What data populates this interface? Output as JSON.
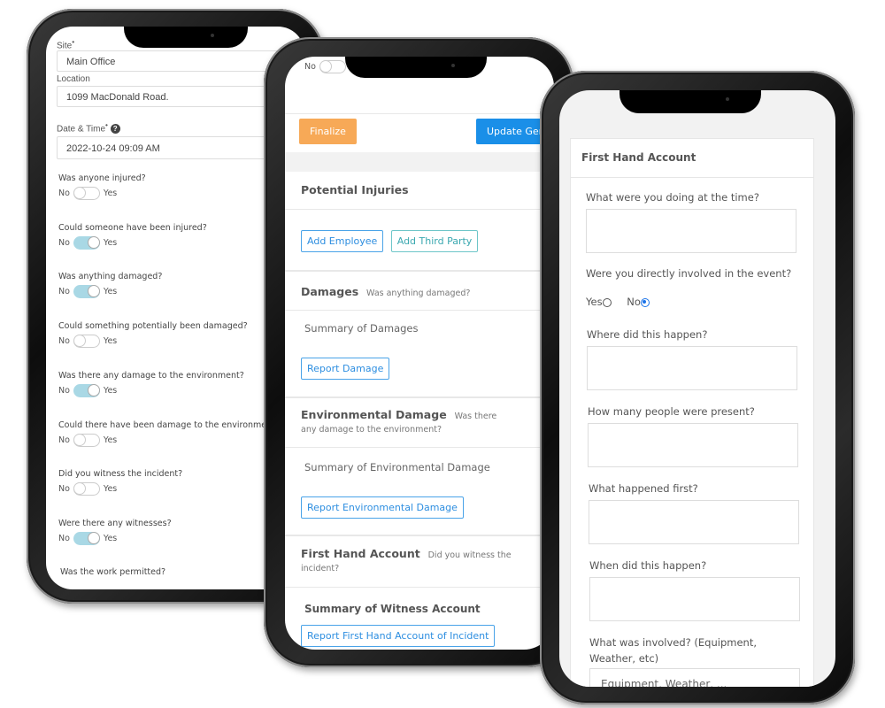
{
  "phone1": {
    "site_label": "Site",
    "site_value": "Main Office",
    "location_label": "Location",
    "location_value": "1099 MacDonald Road.",
    "datetime_label": "Date & Time",
    "datetime_value": "2022-10-24 09:09 AM",
    "no_label": "No",
    "yes_label": "Yes",
    "questions": [
      {
        "text": "Was anyone injured?",
        "on": false
      },
      {
        "text": "Could someone have been injured?",
        "on": true
      },
      {
        "text": "Was anything damaged?",
        "on": true
      },
      {
        "text": "Could something potentially been damaged?",
        "on": false
      },
      {
        "text": "Was there any damage to the environment?",
        "on": true
      },
      {
        "text": "Could there have been damage to the environment?",
        "on": false
      },
      {
        "text": "Did you witness the incident?",
        "on": false
      },
      {
        "text": "Were there any witnesses?",
        "on": true
      }
    ],
    "last_question": "Was the work permitted?"
  },
  "phone2": {
    "top_no": "No",
    "finalize_label": "Finalize",
    "update_label": "Update Gen",
    "potential_injuries": "Potential Injuries",
    "add_employee": "Add Employee",
    "add_third_party": "Add Third Party",
    "damages_title": "Damages",
    "damages_sub": "Was anything damaged?",
    "summary_damages": "Summary of Damages",
    "report_damage": "Report Damage",
    "env_title": "Environmental Damage",
    "env_sub": "Was there any damage to the environment?",
    "summary_env": "Summary of Environmental Damage",
    "report_env": "Report Environmental Damage",
    "fha_title": "First Hand Account",
    "fha_sub": "Did you witness the incident?",
    "summary_witness": "Summary of Witness Account",
    "report_fha": "Report First Hand Account of Incident",
    "colors": {
      "finalize": "#f7a957",
      "update": "#1a8fe8"
    }
  },
  "phone3": {
    "card_title": "First Hand Account",
    "q_doing": "What were you doing at the time?",
    "q_involved": "Were you directly involved in the event?",
    "yes": "Yes",
    "no": "No",
    "selected": "No",
    "q_where": "Where did this happen?",
    "q_people": "How many people were present?",
    "q_first": "What happened first?",
    "q_when": "When did this happen?",
    "q_what": "What was involved? (Equipment, Weather, etc)",
    "what_placeholder": "Equipment, Weather, ..."
  }
}
